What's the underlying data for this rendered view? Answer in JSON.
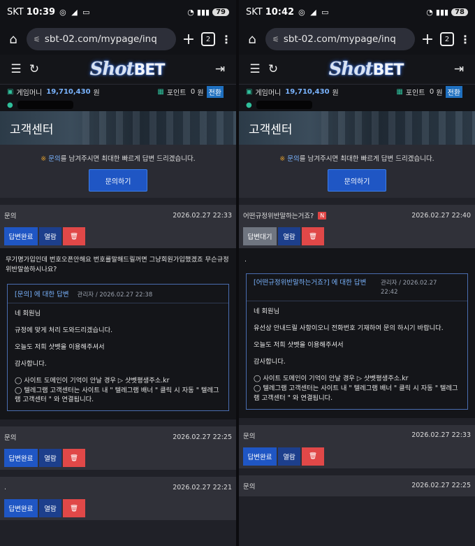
{
  "left": {
    "status": {
      "carrier": "SKT",
      "time": "10:39",
      "battery": "79"
    },
    "url": "sbt-02.com/mypage/inq",
    "tabs_count": "2",
    "site": {
      "logo_shot": "Shot",
      "logo_bet": "BET"
    },
    "money": {
      "label": "게임머니",
      "value": "19,710,430",
      "unit": "원",
      "point_label": "포인트",
      "point_value": "0",
      "point_unit": "원",
      "exchange": "전환"
    },
    "cs_title": "고객센터",
    "notice": {
      "mark": "※",
      "link": "문의",
      "text": "를 남겨주시면 최대한 빠르게 답변 드리겠습니다.",
      "button": "문의하기"
    },
    "inquiries": [
      {
        "title": "문의",
        "date": "2026.02.27 22:33",
        "status": "답변완료",
        "read": "열람"
      },
      {
        "title": "문의",
        "date": "2026.02.27 22:25",
        "status": "답변완료",
        "read": "열람"
      },
      {
        "title": ".",
        "date": "2026.02.27 22:21",
        "status": "답변완료",
        "read": "열람"
      }
    ],
    "question": "무기명가입인데 번호오픈안해요 번호를말해드릴꺼면 그냥회원가입했겠죠 무슨규정위반말씀하시나요?",
    "answer": {
      "title": "[문의] 에 대한 답변",
      "meta": "관리자 / 2026.02.27 22:38",
      "p1": "네 회원님",
      "p2": "규정에 맞게 처리 도와드리겠습니다.",
      "p3": "오늘도 저희 샷벳을 이용해주셔서",
      "p4": "감사합니다.",
      "p5": "◯ 사이트 도메인이 기억이 안날 경우 ▷ 샷벳평생주소.kr",
      "p6": "◯ 텔레그램 고객센터는 사이트 내 \" 텔레그램 배너 \" 클릭 시 자동 \" 텔레그램 고객센터 \" 와 연결됩니다."
    }
  },
  "right": {
    "status": {
      "carrier": "SKT",
      "time": "10:42",
      "battery": "78"
    },
    "url": "sbt-02.com/mypage/inq",
    "tabs_count": "2",
    "site": {
      "logo_shot": "Shot",
      "logo_bet": "BET"
    },
    "money": {
      "label": "게임머니",
      "value": "19,710,430",
      "unit": "원",
      "point_label": "포인트",
      "point_value": "0",
      "point_unit": "원",
      "exchange": "전환"
    },
    "cs_title": "고객센터",
    "notice": {
      "mark": "※",
      "link": "문의",
      "text": "를 남겨주시면 최대한 빠르게 답변 드리겠습니다.",
      "button": "문의하기"
    },
    "inquiries": [
      {
        "title": "어떤규정위반말하는거죠?",
        "badge": "N",
        "date": "2026.02.27 22:40",
        "status": "답변대기",
        "read": "열람"
      },
      {
        "title": "문의",
        "date": "2026.02.27 22:33",
        "status": "답변완료",
        "read": "열람"
      },
      {
        "title": "문의",
        "date": "2026.02.27 22:25"
      }
    ],
    "question": ".",
    "answer": {
      "title": "[어떤규정위반말하는거죠?] 에 대한 답변",
      "meta": "관리자 / 2026.02.27 22:42",
      "p1": "네 회원님",
      "p2": "유선상 안내드릴 사항이오니 전화번호 기재하여 문의 하시기 바랍니다.",
      "p3": "오늘도 저희 샷벳을 이용해주셔서",
      "p4": "감사합니다.",
      "p5": "◯ 사이트 도메인이 기억이 안날 경우 ▷ 샷벳평생주소.kr",
      "p6": "◯ 텔레그램 고객센터는 사이트 내 \" 텔레그램 배너 \" 클릭 시 자동 \" 텔레그램 고객센터 \" 와 연결됩니다."
    }
  },
  "icons": {
    "home": "home-icon",
    "menu": "menu-icon",
    "refresh": "refresh-icon",
    "logout": "logout-icon",
    "trash": "trash-icon",
    "money": "wallet-icon",
    "user": "user-icon"
  }
}
